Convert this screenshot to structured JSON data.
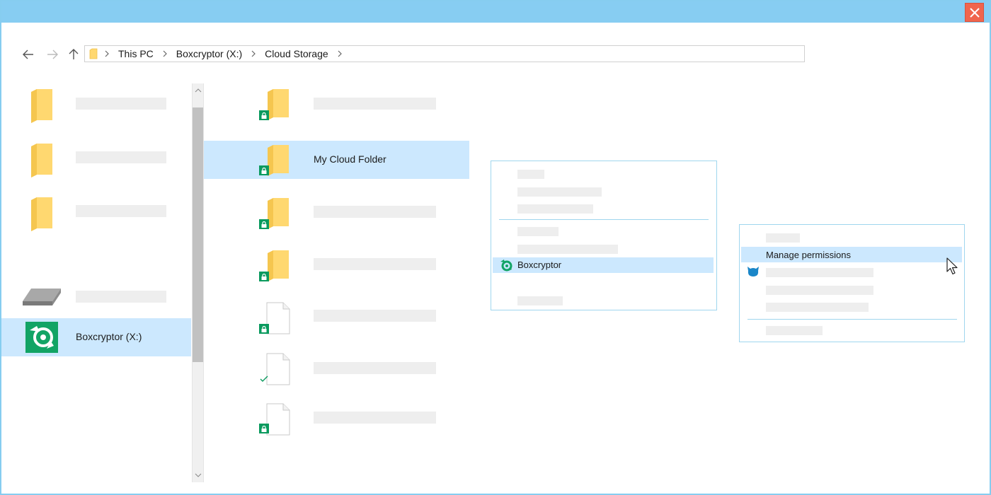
{
  "window": {
    "close_icon": "close-icon",
    "accent": "#87cdf2",
    "close_color": "#f0654d"
  },
  "navigation": {
    "back_icon": "arrow-left-icon",
    "forward_icon": "arrow-right-icon",
    "up_icon": "arrow-up-icon"
  },
  "breadcrumb": {
    "folder_icon": "folder-icon",
    "items": [
      "This PC",
      "Boxcryptor (X:)",
      "Cloud Storage"
    ]
  },
  "sidebar": {
    "selected_item": {
      "label": "Boxcryptor (X:)",
      "icon": "boxcryptor-drive-icon"
    },
    "other_icons": [
      "folder-icon",
      "folder-icon",
      "folder-icon",
      "drive-icon"
    ]
  },
  "files": {
    "selected_item": {
      "label": "My Cloud Folder",
      "icon": "encrypted-folder-icon"
    },
    "status_icons": [
      "lock-badge-icon",
      "lock-badge-icon",
      "lock-badge-icon",
      "lock-badge-icon",
      "lock-badge-icon",
      "check-icon",
      "lock-badge-icon"
    ]
  },
  "context_menu": {
    "highlighted_item": {
      "label": "Boxcryptor",
      "icon": "boxcryptor-logo-icon"
    }
  },
  "submenu": {
    "highlighted_item": {
      "label": "Manage permissions"
    },
    "icon": "whisply-icon",
    "cursor_icon": "mouse-pointer-icon"
  },
  "colors": {
    "selection": "#cce8fe",
    "folder": "#ffd870",
    "lock_badge": "#0a9a5e"
  }
}
